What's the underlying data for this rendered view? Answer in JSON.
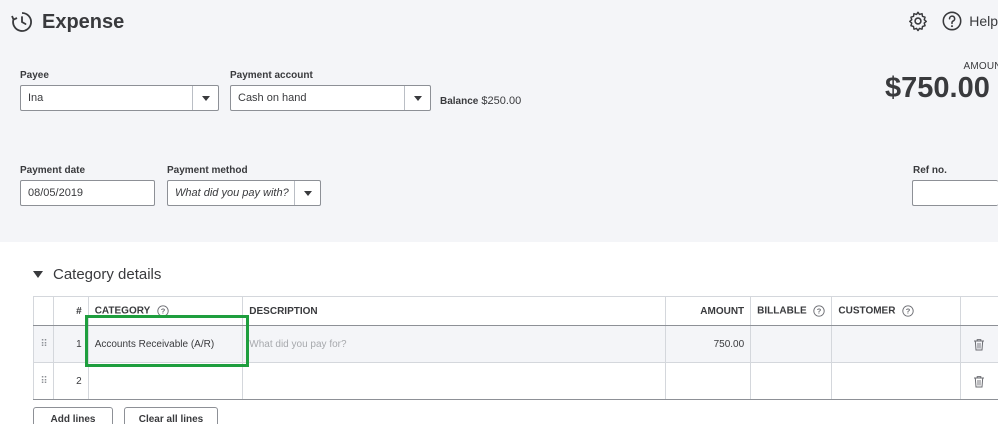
{
  "header": {
    "title": "Expense",
    "help_label": "Help",
    "amount_label": "AMOUNT",
    "amount_value": "$750.00"
  },
  "payee": {
    "label": "Payee",
    "value": "Ina"
  },
  "payment_account": {
    "label": "Payment account",
    "value": "Cash on hand",
    "balance_label": "Balance",
    "balance_value": "$250.00"
  },
  "payment_date": {
    "label": "Payment date",
    "value": "08/05/2019"
  },
  "payment_method": {
    "label": "Payment method",
    "placeholder": "What did you pay with?"
  },
  "ref_no": {
    "label": "Ref no.",
    "value": ""
  },
  "category_details": {
    "title": "Category details",
    "columns": {
      "num": "#",
      "category": "CATEGORY",
      "description": "DESCRIPTION",
      "amount": "AMOUNT",
      "billable": "BILLABLE",
      "customer": "CUSTOMER"
    },
    "rows": [
      {
        "num": "1",
        "category": "Accounts Receivable (A/R)",
        "description_placeholder": "What did you pay for?",
        "amount": "750.00"
      },
      {
        "num": "2",
        "category": "",
        "description_placeholder": "",
        "amount": ""
      }
    ]
  },
  "buttons": {
    "add_lines": "Add lines",
    "clear_all_lines": "Clear all lines"
  },
  "colors": {
    "highlight": "#1e9e3e",
    "header_bg": "#f4f5f8",
    "text": "#393a3d"
  },
  "icons": {
    "title": "recurring-clock-icon",
    "settings": "gear-icon",
    "help": "help-circle-icon",
    "drag": "drag-handle-icon",
    "delete": "trash-icon",
    "info": "question-circle-icon"
  }
}
